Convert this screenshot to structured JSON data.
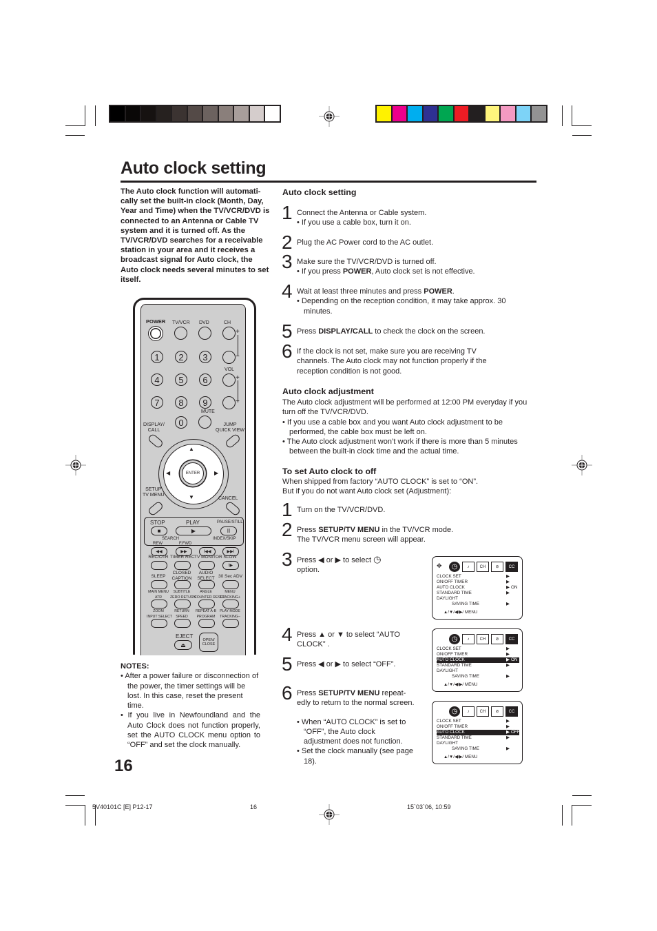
{
  "color_bars": {
    "grayscale": [
      "#000000",
      "#0a0807",
      "#161211",
      "#26211f",
      "#3b3331",
      "#544a47",
      "#6c625f",
      "#8a7f7b",
      "#a89e9b",
      "#d5cdcc",
      "#ffffff"
    ],
    "process": [
      "#fff200",
      "#ec008c",
      "#00aeef",
      "#2e3192",
      "#00a651",
      "#ed1c24",
      "#231f20",
      "#fff57d",
      "#f49ac2",
      "#7dd3f7",
      "#939393"
    ]
  },
  "title": "Auto clock setting",
  "intro": "The Auto clock function will automati-cally set the built-in clock (Month, Day, Year and Time) when the TV/VCR/DVD is connected to an Antenna or Cable TV system and it is turned off. As the TV/VCR/DVD searches for a receivable station in your area and it receives a broadcast signal for Auto clock, the Auto clock needs several minutes to set itself.",
  "remote": {
    "top_labels": {
      "power": "POWER",
      "tvvcr": "TV/VCR",
      "dvd": "DVD",
      "ch": "CH",
      "vol": "VOL",
      "mute": "MUTE",
      "plus": "+",
      "minus": "−"
    },
    "digits": [
      "1",
      "2",
      "3",
      "4",
      "5",
      "6",
      "7",
      "8",
      "9",
      "0"
    ],
    "display_call": "DISPLAY/\nCALL",
    "jump": "JUMP\nQUICK VIEW",
    "enter": "ENTER",
    "setup": "SETUP\nTV MENU",
    "cancel": "CANCEL",
    "arrows": {
      "up": "▲",
      "down": "▼",
      "left": "◀",
      "right": "▶"
    },
    "transport": {
      "stop": "STOP",
      "play": "PLAY",
      "pause": "PAUSE/STILL",
      "search": "SEARCH",
      "rew": "REW",
      "ffwd": "F.FWD",
      "index_skip": "INDEX/SKIP",
      "stop_icon": "■",
      "play_icon": "▶",
      "pause_icon": "II",
      "rew_icon": "◀◀",
      "ffwd_icon": "▶▶",
      "prev_icon": "I◀◀",
      "next_icon": "▶▶I"
    },
    "rows": [
      [
        "REC/OTR",
        "TIMER REC",
        "TV MONITOR",
        "SLOW"
      ],
      [
        "SLEEP",
        "CLOSED\nCAPTION",
        "AUDIO\nSELECT",
        "30 Sec ADV"
      ],
      [
        "MAIN MENU\nATR",
        "SUBTITLE\nZERO RETURN",
        "ANGLE\nCOUNTER RESET",
        "MENU\nTRACKING+"
      ],
      [
        "ZOOM\nINPUT SELECT",
        "RETURN\nSPEED",
        "REPEAT A-B\nPROGRAM",
        "PLAY MODE\nTRACKING−"
      ]
    ],
    "slow_icon": "I▶",
    "eject": "EJECT",
    "eject_icon": "⏏",
    "open_close": "OPEN/\nCLOSE"
  },
  "notes": {
    "heading": "NOTES:",
    "items": [
      "After a power failure or disconnection of the power, the timer settings will be lost. In this case, reset the present time.",
      "If you live in Newfoundland and the Auto Clock does not function properly, set the AUTO CLOCK menu option to “OFF” and set the clock manually."
    ]
  },
  "page_number": "16",
  "section1": {
    "heading": "Auto clock setting",
    "steps": [
      {
        "n": "1",
        "text": "Connect the Antenna or Cable system.",
        "bullet": "If you use a cable box, turn it on."
      },
      {
        "n": "2",
        "text": "Plug the AC Power cord to the AC outlet."
      },
      {
        "n": "3",
        "text": "Make sure the TV/VCR/DVD is turned off.",
        "bullet_pre": "If you press ",
        "bullet_bold": "POWER",
        "bullet_post": ", Auto clock set is not effective."
      },
      {
        "n": "4",
        "text_pre": "Wait at least three minutes and press ",
        "text_bold": "POWER",
        "text_post": ".",
        "bullet": "Depending on the reception condition, it may take approx. 30 minutes."
      },
      {
        "n": "5",
        "text_pre": "Press ",
        "text_bold": "DISPLAY/CALL",
        "text_post": " to check the clock on the screen."
      },
      {
        "n": "6",
        "text": "If the clock is not set, make sure you are receiving TV channels. The Auto clock may not function properly if the reception condition is not good."
      }
    ]
  },
  "section2": {
    "heading": "Auto clock adjustment",
    "body": "The Auto clock adjustment will be performed at 12:00 PM everyday if you turn off the TV/VCR/DVD.",
    "bullets": [
      "If you use a cable box and you want Auto clock adjustment to be performed, the cable box must be left on.",
      "The Auto clock adjustment won’t work if there is more than 5 minutes between the built-in clock time and the actual time."
    ]
  },
  "section3": {
    "heading": "To set Auto clock to off",
    "line1": "When shipped from factory “AUTO CLOCK” is set to “ON”.",
    "line2": "But if you do not want Auto clock set (Adjustment):",
    "steps": [
      {
        "n": "1",
        "text": "Turn on the TV/VCR/DVD."
      },
      {
        "n": "2",
        "text_pre": "Press ",
        "text_bold": "SETUP/TV MENU",
        "text_post": " in the TV/VCR mode.",
        "line2": "The TV/VCR menu screen will appear."
      },
      {
        "n": "3",
        "text_pre": "Press ◀ or ▶ to select ",
        "text_post": "option.",
        "icon": "◷"
      },
      {
        "n": "4",
        "text": "Press ▲ or ▼ to select “AUTO CLOCK” ."
      },
      {
        "n": "5",
        "text": "Press ◀ or ▶ to select “OFF”."
      },
      {
        "n": "6",
        "text_pre": "Press ",
        "text_bold": "SETUP/TV MENU",
        "text_post": " repeat-edly to return to the normal screen.",
        "bullets": [
          "When “AUTO CLOCK” is set to “OFF”, the Auto clock adjustment does not function.",
          "Set the clock manually (see page 18)."
        ]
      }
    ]
  },
  "menu_screens": [
    {
      "nav_icon": "✥",
      "icons": [
        "◷",
        "♪",
        "CH",
        "⊘",
        "CC"
      ],
      "rows": [
        "CLOCK SET",
        "ON/OFF TIMER",
        "AUTO CLOCK",
        "STANDARD TIME",
        "DAYLIGHT",
        "SAVING TIME"
      ],
      "arrows": [
        "▶",
        "▶",
        "▶",
        "▶",
        "",
        "▶"
      ],
      "auto_value": "ON",
      "highlight": false,
      "footer": "▲/▼/◀/▶/ MENU"
    },
    {
      "icons": [
        "◷",
        "♪",
        "CH",
        "⊘",
        "CC"
      ],
      "rows": [
        "CLOCK SET",
        "ON/OFF TIMER",
        "AUTO CLOCK",
        "STANDARD TIME",
        "DAYLIGHT",
        "SAVING TIME"
      ],
      "arrows": [
        "▶",
        "▶",
        "▶",
        "▶",
        "",
        "▶"
      ],
      "auto_value": "ON",
      "highlight": true,
      "footer": "▲/▼/◀/▶/ MENU"
    },
    {
      "icons": [
        "◷",
        "♪",
        "CH",
        "⊘",
        "CC"
      ],
      "rows": [
        "CLOCK SET",
        "ON/OFF TIMER",
        "AUTO CLOCK",
        "STANDARD TIME",
        "DAYLIGHT",
        "SAVING TIME"
      ],
      "arrows": [
        "▶",
        "▶",
        "▶",
        "▶",
        "",
        "▶"
      ],
      "auto_value": "OFF",
      "highlight": true,
      "footer": "▲/▼/◀/▶/ MENU"
    }
  ],
  "footer": {
    "code": "5V40101C [E] P12-17",
    "page": "16",
    "date": "15`03`06, 10:59"
  }
}
